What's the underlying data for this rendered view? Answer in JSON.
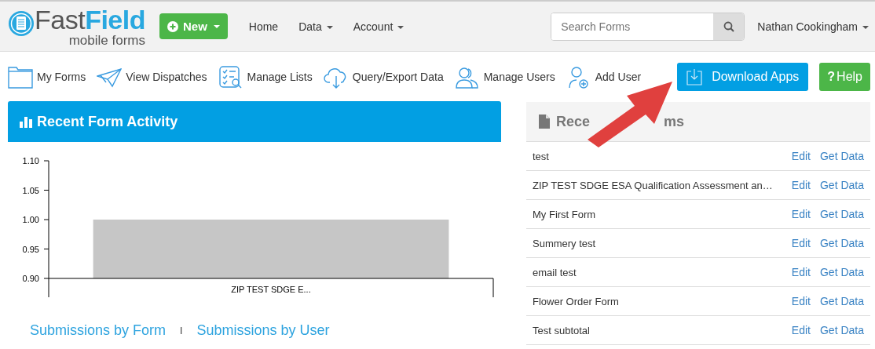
{
  "brand": {
    "name_a": "Fast",
    "name_b": "Field",
    "tagline": "mobile forms"
  },
  "navbar": {
    "new_button": "New",
    "links": [
      {
        "label": "Home",
        "dropdown": false
      },
      {
        "label": "Data",
        "dropdown": true
      },
      {
        "label": "Account",
        "dropdown": true
      }
    ],
    "search": {
      "placeholder": "Search Forms"
    },
    "user": "Nathan Cookingham"
  },
  "toolbar": {
    "items": [
      {
        "label": "My Forms",
        "kind": "folder"
      },
      {
        "label": "View Dispatches",
        "kind": "plane"
      },
      {
        "label": "Manage Lists",
        "kind": "list"
      },
      {
        "label": "Query/Export Data",
        "kind": "cloud"
      },
      {
        "label": "Manage Users",
        "kind": "users"
      },
      {
        "label": "Add User",
        "kind": "adduser"
      }
    ],
    "download_button": "Download Apps",
    "help_icon": "?",
    "help_button": "Help"
  },
  "activity": {
    "title": "Recent Form Activity",
    "chart_data": {
      "type": "bar",
      "categories": [
        "ZIP TEST SDGE E..."
      ],
      "values": [
        1.0
      ],
      "ylim": [
        0.9,
        1.1
      ],
      "yticks": [
        {
          "value": 0.9,
          "label": "0.90"
        },
        {
          "value": 0.95,
          "label": "0.95"
        },
        {
          "value": 1.0,
          "label": "1.00"
        },
        {
          "value": 1.05,
          "label": "1.05"
        },
        {
          "value": 1.1,
          "label": "1.10"
        }
      ]
    },
    "links": [
      "Submissions by Form",
      "Submissions by User"
    ],
    "separator": "I"
  },
  "recent_forms": {
    "title_parts": [
      "Rece",
      "ms"
    ],
    "rows": [
      {
        "name": "test",
        "edit": "Edit",
        "get_data": "Get Data"
      },
      {
        "name": "ZIP TEST SDGE ESA Qualification Assessment an…",
        "edit": "Edit",
        "get_data": "Get Data"
      },
      {
        "name": "My First Form",
        "edit": "Edit",
        "get_data": "Get Data"
      },
      {
        "name": "Summery test",
        "edit": "Edit",
        "get_data": "Get Data"
      },
      {
        "name": "email test",
        "edit": "Edit",
        "get_data": "Get Data"
      },
      {
        "name": "Flower Order Form",
        "edit": "Edit",
        "get_data": "Get Data"
      },
      {
        "name": "Test subtotal",
        "edit": "Edit",
        "get_data": "Get Data"
      }
    ]
  }
}
